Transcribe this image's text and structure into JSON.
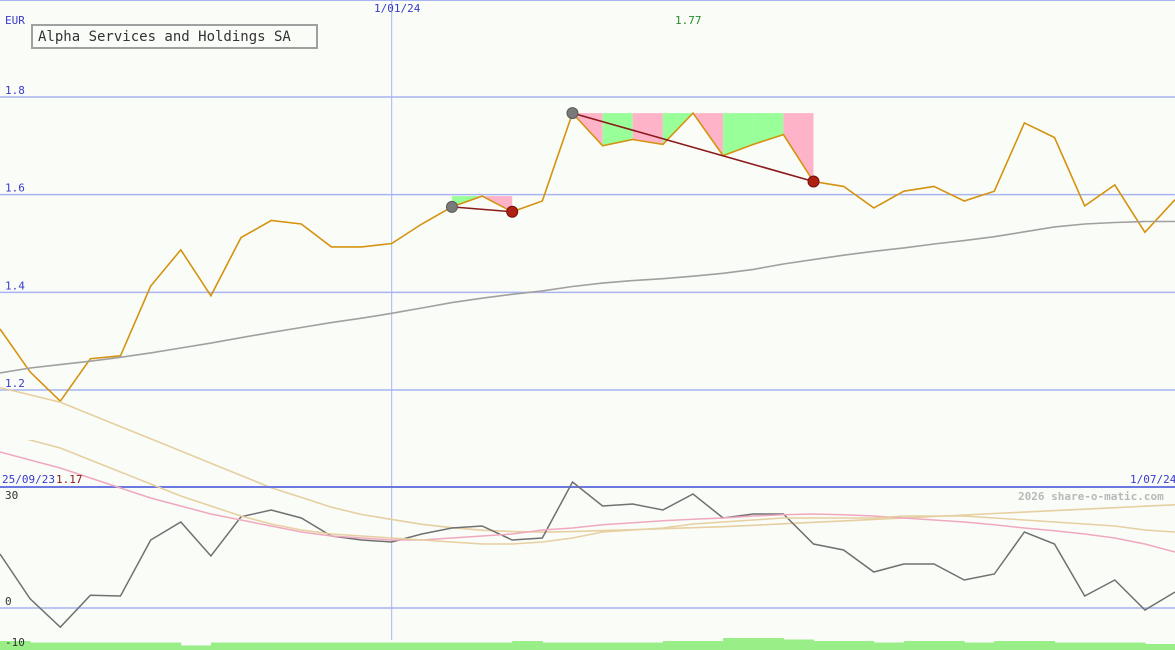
{
  "chart_data": [
    {
      "type": "line",
      "title": "Alpha Services and Holdings SA",
      "ylabel": "EUR",
      "ylim": [
        1.1,
        1.9
      ],
      "yticks": [
        "1.2",
        "1.4",
        "1.6",
        "1.8"
      ],
      "ytick_values": [
        1.2,
        1.4,
        1.6,
        1.8
      ],
      "date_labels": [
        "1/01/24",
        "25/09/23",
        "1/07/24"
      ],
      "max_label": "1.77",
      "min_label": "1.17",
      "x": [
        0,
        1,
        2,
        3,
        4,
        5,
        6,
        7,
        8,
        9,
        10,
        11,
        12,
        13,
        14,
        15,
        16,
        17,
        18,
        19,
        20,
        21,
        22,
        23,
        24,
        25,
        26,
        27,
        28,
        29,
        30,
        31,
        32,
        33,
        34,
        35,
        36,
        37,
        38,
        39
      ],
      "series": [
        {
          "color": "#d4930f",
          "values": [
            1.325,
            1.237,
            1.177,
            1.264,
            1.27,
            1.413,
            1.487,
            1.393,
            1.512,
            1.547,
            1.54,
            1.493,
            1.493,
            1.5,
            1.54,
            1.575,
            1.597,
            1.565,
            1.587,
            1.767,
            1.7,
            1.713,
            1.703,
            1.767,
            1.68,
            1.703,
            1.723,
            1.627,
            1.617,
            1.573,
            1.607,
            1.617,
            1.587,
            1.607,
            1.747,
            1.717,
            1.577,
            1.62,
            1.523,
            1.59
          ]
        },
        {
          "color": "#a0a0a0",
          "values": [
            1.235,
            1.245,
            1.252,
            1.259,
            1.267,
            1.276,
            1.286,
            1.296,
            1.307,
            1.318,
            1.328,
            1.338,
            1.347,
            1.357,
            1.368,
            1.379,
            1.388,
            1.396,
            1.403,
            1.412,
            1.419,
            1.424,
            1.428,
            1.433,
            1.439,
            1.447,
            1.458,
            1.467,
            1.476,
            1.484,
            1.491,
            1.499,
            1.506,
            1.514,
            1.524,
            1.534,
            1.54,
            1.543,
            1.545,
            1.545
          ]
        },
        {
          "color": "#e6cfa0",
          "values": [
            1.205,
            1.19,
            1.175,
            1.15,
            1.125,
            1.1,
            1.075,
            1.05,
            1.025,
            1.0,
            0.98,
            0.96,
            0.945,
            0.935,
            0.925,
            0.918,
            0.913,
            0.91,
            0.909,
            0.91,
            0.912,
            0.914,
            0.916,
            0.918,
            0.92,
            0.923,
            0.926,
            0.929,
            0.932,
            0.935,
            0.938,
            0.941,
            0.944,
            0.947,
            0.95,
            0.953,
            0.956,
            0.959,
            0.962,
            0.965
          ]
        }
      ],
      "trendlines": [
        {
          "x": [
            15,
            17
          ],
          "y": [
            1.575,
            1.565
          ]
        },
        {
          "x": [
            19,
            27
          ],
          "y": [
            1.767,
            1.627
          ]
        }
      ],
      "highlight_shading": [
        {
          "start": 15,
          "end": 17,
          "level": 1.597,
          "up_color": "#99ff99",
          "down_color": "#ffb3c8"
        },
        {
          "start": 19,
          "end": 27,
          "level": 1.767,
          "up_color": "#99ff99",
          "down_color": "#ffb3c8"
        }
      ],
      "grid": true,
      "vertical_marker_x": 13
    },
    {
      "type": "line",
      "title": "",
      "watermark": "2026 share-o-matic.com",
      "ylim": [
        -10,
        30
      ],
      "yticks": [
        "30",
        "0",
        "-10"
      ],
      "ytick_values": [
        30,
        0,
        -10
      ],
      "x": [
        0,
        1,
        2,
        3,
        4,
        5,
        6,
        7,
        8,
        9,
        10,
        11,
        12,
        13,
        14,
        15,
        16,
        17,
        18,
        19,
        20,
        21,
        22,
        23,
        24,
        25,
        26,
        27,
        28,
        29,
        30,
        31,
        32,
        33,
        34,
        35,
        36,
        37,
        38,
        39
      ],
      "series": [
        {
          "color": "#707070",
          "values": [
            13.5,
            2.3,
            -4.8,
            3.2,
            3.0,
            17.0,
            21.5,
            13.0,
            22.8,
            24.5,
            22.5,
            18.0,
            17.0,
            16.5,
            18.5,
            20.0,
            20.5,
            17.0,
            17.5,
            31.5,
            25.5,
            26.0,
            24.5,
            28.5,
            22.5,
            23.5,
            23.5,
            16.0,
            14.5,
            9.0,
            11.0,
            11.0,
            7.0,
            8.5,
            19.0,
            16.0,
            3.0,
            7.0,
            -0.5,
            4.0
          ]
        },
        {
          "color": "#f0a8c0",
          "values": [
            39.0,
            37.0,
            35.0,
            32.5,
            30.0,
            27.5,
            25.5,
            23.5,
            22.0,
            20.5,
            19.0,
            18.0,
            17.5,
            17.0,
            17.0,
            17.5,
            18.0,
            18.5,
            19.5,
            20.0,
            20.8,
            21.3,
            21.8,
            22.2,
            22.5,
            23.0,
            23.3,
            23.5,
            23.3,
            23.0,
            22.5,
            22.0,
            21.5,
            20.8,
            20.0,
            19.3,
            18.5,
            17.5,
            16.0,
            14.0
          ]
        },
        {
          "color": "#e6cfa0",
          "values": [
            44.0,
            42.0,
            40.0,
            37.0,
            34.0,
            31.0,
            28.0,
            25.5,
            23.0,
            21.0,
            19.5,
            18.5,
            18.0,
            17.5,
            17.0,
            16.5,
            16.0,
            16.0,
            16.5,
            17.5,
            19.0,
            19.5,
            20.0,
            21.0,
            21.5,
            22.0,
            22.5,
            22.5,
            22.5,
            22.5,
            23.0,
            23.0,
            23.0,
            22.5,
            22.0,
            21.5,
            21.0,
            20.5,
            19.5,
            19.0
          ]
        }
      ],
      "volume_bars": [
        3,
        2.5,
        2.5,
        2.5,
        2.5,
        2.5,
        1.5,
        2.5,
        2.5,
        2.5,
        2.5,
        2.5,
        2.5,
        2.5,
        2.5,
        2.5,
        2.5,
        3,
        2.5,
        2.5,
        2.5,
        2.5,
        3,
        3,
        4,
        4,
        3.5,
        3,
        3,
        2.5,
        3,
        3,
        2.5,
        3,
        3,
        2.5,
        2.5,
        2.5,
        2,
        3
      ],
      "volume_color": "#99ee88",
      "grid": true,
      "vertical_marker_x": 13
    }
  ]
}
